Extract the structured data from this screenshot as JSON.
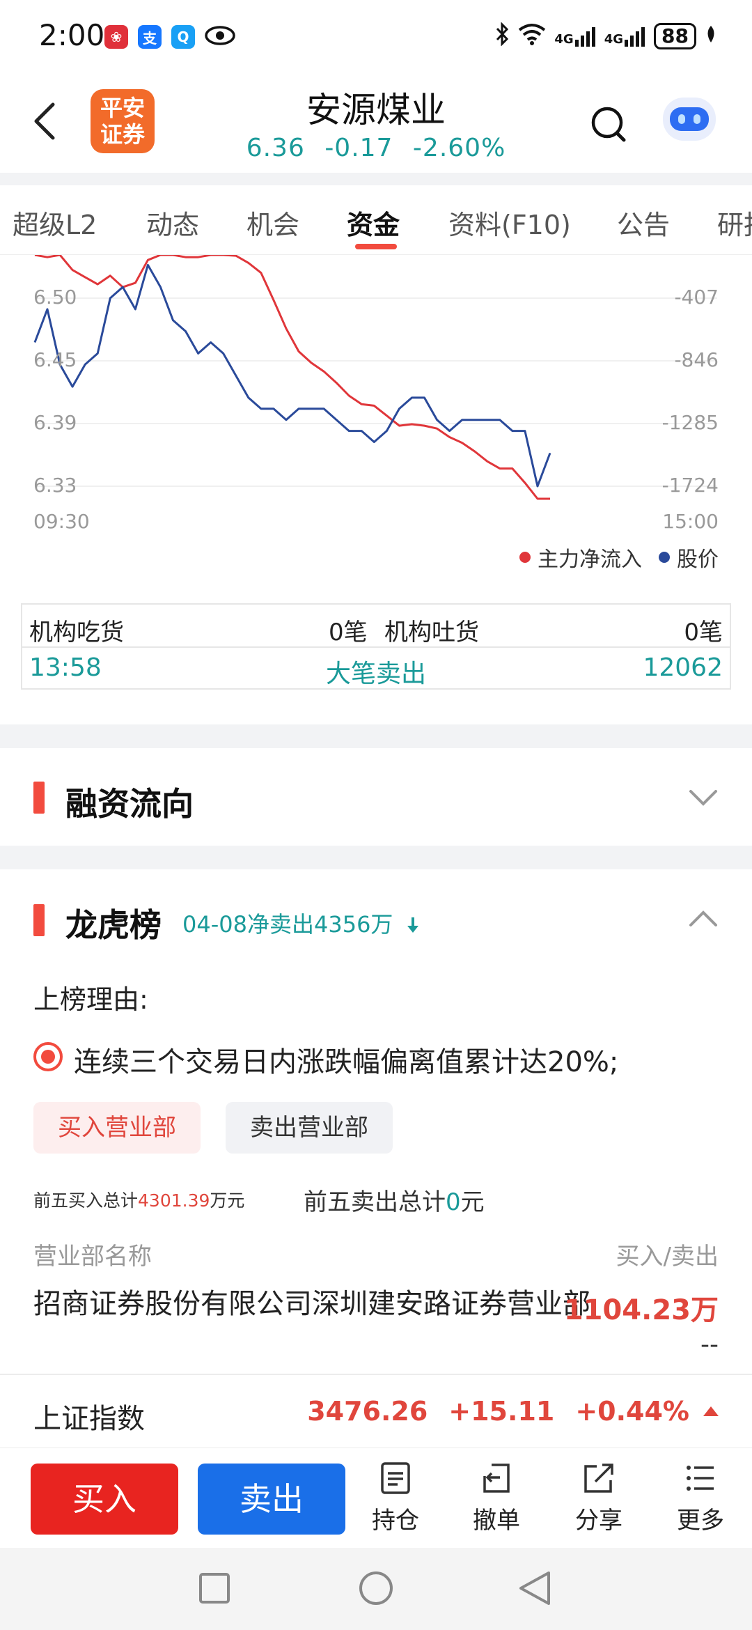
{
  "status_bar": {
    "time": "2:00",
    "network_1": "4G",
    "network_2": "4G",
    "battery": "88",
    "apps": [
      "huawei-app-icon",
      "alipay-icon",
      "search-app-icon",
      "eye-icon"
    ]
  },
  "header": {
    "logo_text_line1": "平安",
    "logo_text_line2": "证券",
    "stock_name": "安源煤业",
    "price": "6.36",
    "change": "-0.17",
    "change_pct": "-2.60%"
  },
  "tabs": [
    {
      "label": "超级L2"
    },
    {
      "label": "动态"
    },
    {
      "label": "机会"
    },
    {
      "label": "资金",
      "active": true
    },
    {
      "label": "资料(F10)"
    },
    {
      "label": "公告"
    },
    {
      "label": "研报"
    }
  ],
  "chart_data": {
    "type": "line",
    "y_left_ticks": [
      "6.50",
      "6.45",
      "6.39",
      "6.33"
    ],
    "y_right_ticks": [
      "-407",
      "-846",
      "-1285",
      "-1724"
    ],
    "x_ticks": [
      "09:30",
      "15:00"
    ],
    "series": [
      {
        "name": "主力净流入",
        "color": "#e0363a",
        "values": [
          -60,
          -120,
          -90,
          -210,
          -260,
          -310,
          -250,
          -330,
          -300,
          -140,
          -60,
          10,
          -120,
          -120,
          -70,
          -100,
          -110,
          -160,
          -230,
          -420,
          -620,
          -780,
          -860,
          -920,
          -1000,
          -1090,
          -1150,
          -1160,
          -1230,
          -1300,
          -1290,
          -1300,
          -1320,
          -1380,
          -1420,
          -1480,
          -1550,
          -1600,
          -1600,
          -1700,
          -2050,
          -2030
        ]
      },
      {
        "name": "股价",
        "color": "#2a4a9a",
        "values": [
          6.46,
          6.49,
          6.44,
          6.42,
          6.44,
          6.45,
          6.5,
          6.51,
          6.49,
          6.53,
          6.51,
          6.48,
          6.47,
          6.45,
          6.46,
          6.45,
          6.43,
          6.41,
          6.4,
          6.4,
          6.39,
          6.4,
          6.4,
          6.4,
          6.39,
          6.38,
          6.38,
          6.37,
          6.38,
          6.4,
          6.41,
          6.41,
          6.39,
          6.38,
          6.39,
          6.39,
          6.39,
          6.39,
          6.38,
          6.38,
          6.33,
          6.36
        ]
      }
    ],
    "legend": [
      "主力净流入",
      "股价"
    ],
    "legend_position": "bottom-right"
  },
  "institution": {
    "eat_label": "机构吃货",
    "eat_value": "0笔",
    "spit_label": "机构吐货",
    "spit_value": "0笔",
    "time": "13:58",
    "event": "大笔卖出",
    "volume": "12062"
  },
  "margin_flow": {
    "title": "融资流向"
  },
  "lhb": {
    "title": "龙虎榜",
    "subtitle": "04-08净卖出4356万",
    "reason_label": "上榜理由:",
    "reason": "连续三个交易日内涨跌幅偏离值累计达20%;",
    "tab_buy": "买入营业部",
    "tab_sell": "卖出营业部",
    "buy_total_prefix": "前五买入总计",
    "buy_total_value": "4301.39",
    "buy_total_unit": "万元",
    "sell_total_prefix": "前五卖出总计",
    "sell_total_value": "0",
    "sell_total_unit": "元",
    "col_name": "营业部名称",
    "col_value": "买入/卖出",
    "broker_name": "招商证券股份有限公司深圳建安路证券营业部",
    "broker_buy": "1104.23万",
    "broker_sell": "--"
  },
  "index_bar": {
    "name": "上证指数",
    "value": "3476.26",
    "change": "+15.11",
    "change_pct": "+0.44%"
  },
  "actions": {
    "buy": "买入",
    "sell": "卖出",
    "hold": "持仓",
    "cancel": "撤单",
    "share": "分享",
    "more": "更多"
  }
}
